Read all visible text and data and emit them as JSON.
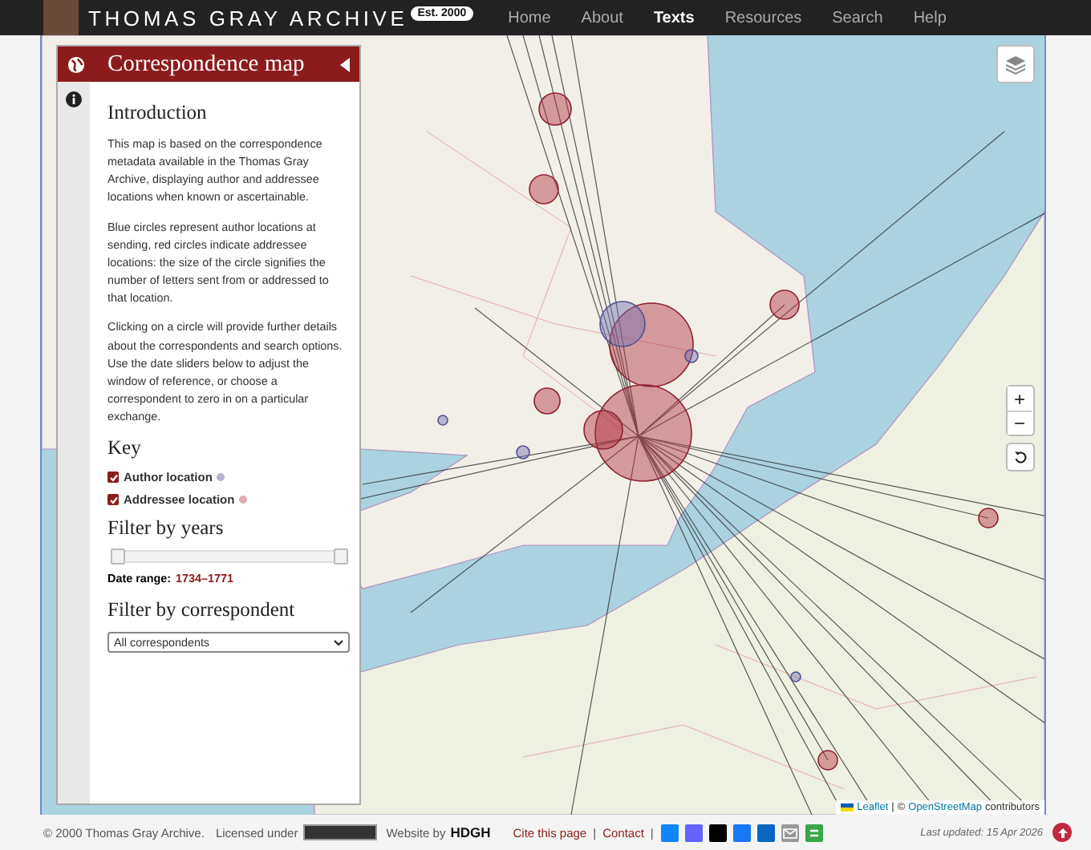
{
  "header": {
    "title": "THOMAS GRAY ARCHIVE",
    "badge": "Est. 2000",
    "nav": [
      {
        "label": "Home",
        "selected": false
      },
      {
        "label": "About",
        "selected": false
      },
      {
        "label": "Texts",
        "selected": true
      },
      {
        "label": "Resources",
        "selected": false
      },
      {
        "label": "Search",
        "selected": false
      },
      {
        "label": "Help",
        "selected": false
      }
    ]
  },
  "sidebar": {
    "title": "Correspondence map",
    "intro_heading": "Introduction",
    "paragraphs": [
      "This map is based on the correspondence metadata available in the Thomas Gray Archive, displaying author and addressee locations when known or ascertainable.",
      "Blue circles represent author locations at sending, red circles indicate addressee locations: the size of the circle signifies the number of letters sent from or addressed to that location.",
      "Clicking on a circle will provide further details about the correspondents and search options. Use the date sliders below to adjust the window of reference, or choose a correspondent to zero in on a particular exchange."
    ],
    "key_heading": "Key",
    "key_items": [
      {
        "label": "Author location",
        "checked": true,
        "color": "#b4b4d4"
      },
      {
        "label": "Addressee location",
        "checked": true,
        "color": "#e2a9b0"
      }
    ],
    "years_heading": "Filter by years",
    "year_slider": {
      "level": 1
    },
    "date_range_label": "Date range:",
    "date_range_value": "1734–1771",
    "correspondent_heading": "Filter by correspondent",
    "correspondent_select": {
      "value": "All correspondents"
    }
  },
  "map": {
    "zoom_in": "+",
    "zoom_out": "−",
    "attribution": {
      "leaflet": "Leaflet",
      "separator": "|",
      "copyright": "©",
      "osm": "OpenStreetMap",
      "suffix": "contributors"
    }
  },
  "footer": {
    "copyright": "© 2000 Thomas Gray Archive.",
    "licensed": "Licensed under",
    "website_by": "Website by",
    "studio": "HDGH",
    "links": [
      "Cite this page",
      "Contact"
    ],
    "separator": "|",
    "last_updated": "Last updated: 15 Apr 2026"
  }
}
